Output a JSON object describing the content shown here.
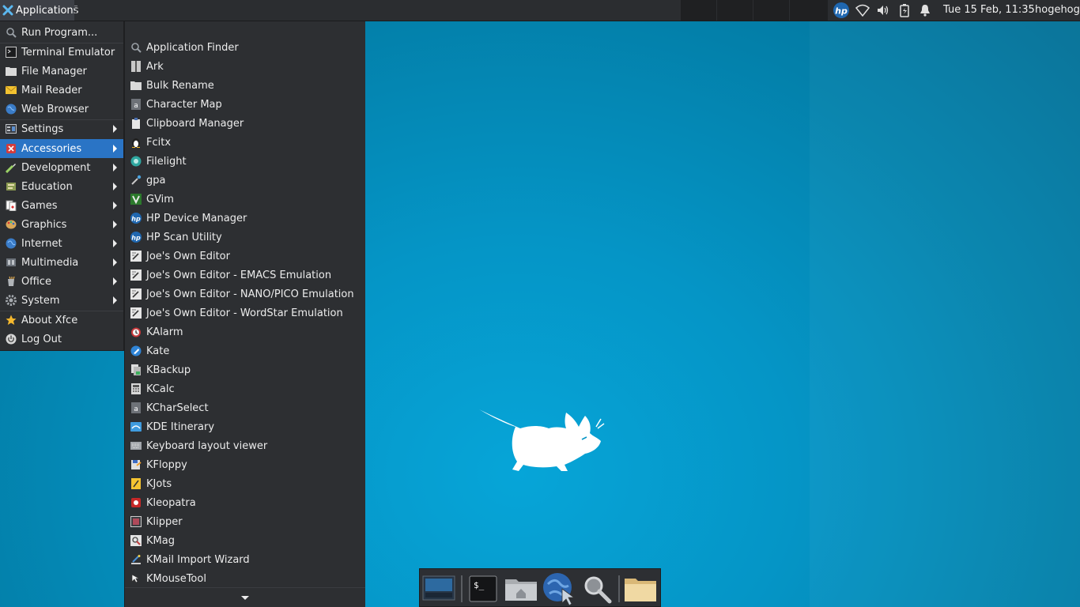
{
  "top_panel": {
    "applications_label": "Applications",
    "clock": "Tue 15 Feb, 11:35",
    "user": "hogehoge",
    "tray_icons": [
      "hp-icon",
      "wifi-icon",
      "volume-icon",
      "battery-icon",
      "notification-bell-icon"
    ]
  },
  "main_menu": {
    "items": [
      {
        "label": "Run Program...",
        "icon": "search-icon"
      },
      {
        "label": "Terminal Emulator",
        "icon": "terminal-icon"
      },
      {
        "label": "File Manager",
        "icon": "folder-icon"
      },
      {
        "label": "Mail Reader",
        "icon": "mail-icon"
      },
      {
        "label": "Web Browser",
        "icon": "globe-icon"
      },
      {
        "label": "Settings",
        "icon": "settings-icon",
        "submenu": true
      },
      {
        "label": "Accessories",
        "icon": "accessories-icon",
        "submenu": true,
        "active": true
      },
      {
        "label": "Development",
        "icon": "development-icon",
        "submenu": true
      },
      {
        "label": "Education",
        "icon": "education-icon",
        "submenu": true
      },
      {
        "label": "Games",
        "icon": "games-icon",
        "submenu": true
      },
      {
        "label": "Graphics",
        "icon": "graphics-icon",
        "submenu": true
      },
      {
        "label": "Internet",
        "icon": "internet-icon",
        "submenu": true
      },
      {
        "label": "Multimedia",
        "icon": "multimedia-icon",
        "submenu": true
      },
      {
        "label": "Office",
        "icon": "office-icon",
        "submenu": true
      },
      {
        "label": "System",
        "icon": "system-icon",
        "submenu": true
      },
      {
        "label": "About Xfce",
        "icon": "star-icon"
      },
      {
        "label": "Log Out",
        "icon": "power-icon"
      }
    ]
  },
  "accessories_menu": {
    "items": [
      {
        "label": "Application Finder",
        "icon": "search-icon"
      },
      {
        "label": "Ark",
        "icon": "archive-icon"
      },
      {
        "label": "Bulk Rename",
        "icon": "folder-icon"
      },
      {
        "label": "Character Map",
        "icon": "character-map-icon"
      },
      {
        "label": "Clipboard Manager",
        "icon": "clipboard-icon"
      },
      {
        "label": "Fcitx",
        "icon": "penguin-icon"
      },
      {
        "label": "Filelight",
        "icon": "filelight-icon"
      },
      {
        "label": "gpa",
        "icon": "key-icon"
      },
      {
        "label": "GVim",
        "icon": "vim-icon"
      },
      {
        "label": "HP Device Manager",
        "icon": "hp-icon"
      },
      {
        "label": "HP Scan Utility",
        "icon": "hp-icon"
      },
      {
        "label": "Joe's Own Editor",
        "icon": "editor-icon"
      },
      {
        "label": "Joe's Own Editor - EMACS Emulation",
        "icon": "editor-icon"
      },
      {
        "label": "Joe's Own Editor - NANO/PICO Emulation",
        "icon": "editor-icon"
      },
      {
        "label": "Joe's Own Editor - WordStar Emulation",
        "icon": "editor-icon"
      },
      {
        "label": "KAlarm",
        "icon": "alarm-icon"
      },
      {
        "label": "Kate",
        "icon": "kate-icon"
      },
      {
        "label": "KBackup",
        "icon": "backup-icon"
      },
      {
        "label": "KCalc",
        "icon": "calculator-icon"
      },
      {
        "label": "KCharSelect",
        "icon": "character-map-icon"
      },
      {
        "label": "KDE Itinerary",
        "icon": "itinerary-icon"
      },
      {
        "label": "Keyboard layout viewer",
        "icon": "keyboard-icon"
      },
      {
        "label": "KFloppy",
        "icon": "floppy-icon"
      },
      {
        "label": "KJots",
        "icon": "notes-icon"
      },
      {
        "label": "Kleopatra",
        "icon": "kleopatra-icon"
      },
      {
        "label": "Klipper",
        "icon": "klipper-icon"
      },
      {
        "label": "KMag",
        "icon": "magnifier-icon"
      },
      {
        "label": "KMail Import Wizard",
        "icon": "import-wizard-icon"
      },
      {
        "label": "KMouseTool",
        "icon": "mouse-tool-icon"
      }
    ]
  },
  "dock": {
    "items": [
      {
        "name": "show-desktop-icon"
      },
      {
        "name": "terminal-icon"
      },
      {
        "name": "home-folder-icon"
      },
      {
        "name": "web-browser-icon"
      },
      {
        "name": "app-finder-icon"
      },
      {
        "name": "folder-icon"
      }
    ]
  },
  "colors": {
    "panel": "#2b2d30",
    "menu_bg": "#2d2f32",
    "highlight": "#2a74c5",
    "desktop": "#0595c6"
  }
}
